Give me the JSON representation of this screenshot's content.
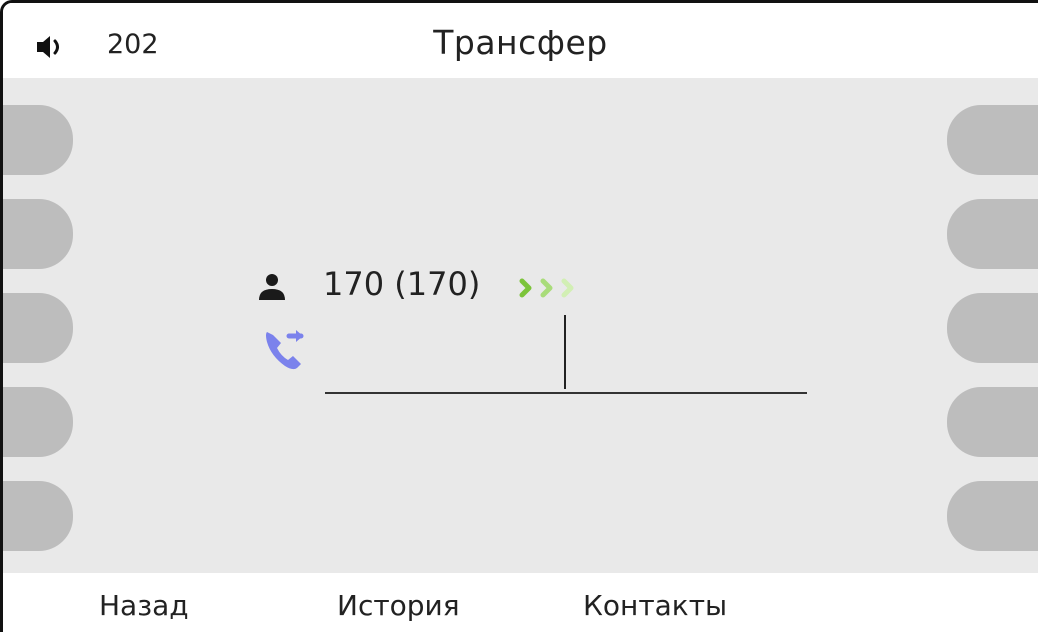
{
  "header": {
    "speaker_icon": "speaker-volume-icon",
    "line_number": "202",
    "title": "Трансфер"
  },
  "call": {
    "contact_icon": "person-icon",
    "contact_label": "170 (170)",
    "status_icon": "progress-chevrons-icon",
    "transfer_icon": "call-transfer-icon",
    "input_value": ""
  },
  "side_keys": {
    "left_count": 5,
    "right_count": 5
  },
  "softkeys": [
    {
      "label": "Назад"
    },
    {
      "label": "История"
    },
    {
      "label": "Контакты"
    }
  ],
  "colors": {
    "main_bg": "#e9e9e9",
    "side_key": "#bdbdbd",
    "transfer_icon": "#7b82ec",
    "progress_dark": "#7cc43a",
    "progress_mid": "#a9dc7a",
    "progress_light": "#d2efb4"
  }
}
